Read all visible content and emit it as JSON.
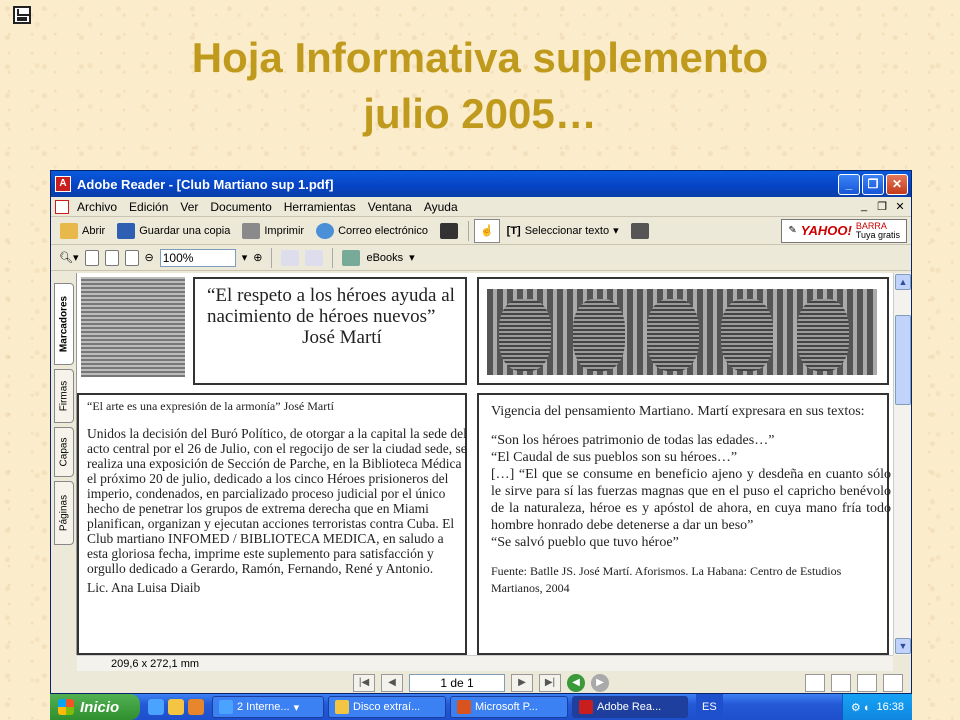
{
  "slide": {
    "title_line1": "Hoja Informativa suplemento",
    "title_line2": "julio 2005…",
    "title_color": "#c09a1c"
  },
  "window": {
    "title": "Adobe Reader - [Club Martiano sup 1.pdf]",
    "menu": [
      "Archivo",
      "Edición",
      "Ver",
      "Documento",
      "Herramientas",
      "Ventana",
      "Ayuda"
    ],
    "toolbar": {
      "open_label": "Abrir",
      "save_copy_label": "Guardar una copia",
      "print_label": "Imprimir",
      "email_label": "Correo electrónico",
      "select_text_label": "Seleccionar texto",
      "yahoo_logo": "YAHOO!",
      "yahoo_bar": "BARRA",
      "yahoo_sub": "Tuya gratis"
    },
    "toolbar2": {
      "zoom_value": "100%",
      "ebooks_label": "eBooks"
    },
    "side_tabs": [
      "Marcadores",
      "Firmas",
      "Capas",
      "Páginas"
    ]
  },
  "document": {
    "quote": "“El respeto a los héroes ayuda al nacimiento de héroes nuevos”",
    "quote_author": "José Martí",
    "col1_heading": "“El arte es una expresión de la armonía”",
    "col1_heading_author": "José Martí",
    "col1_body": "Unidos la decisión del Buró Político, de otorgar a la capital la sede del acto central por el 26 de Julio, con el regocijo de ser la ciudad sede, se realiza una exposición de Sección de Parche, en la Biblioteca Médica el próximo 20 de julio, dedicado a los cinco Héroes prisioneros del imperio, condenados, en parcializado proceso judicial por el único hecho de penetrar los grupos de extrema derecha que en Miami planifican, organizan y ejecutan acciones terroristas contra Cuba. El Club martiano INFOMED / BIBLIOTECA MEDICA, en saludo a esta gloriosa fecha, imprime este suplemento para satisfacción y orgullo dedicado a Gerardo, Ramón, Fernando, René y Antonio.",
    "col1_footer": "Lic. Ana Luisa Diaib",
    "col2_intro": "Vigencia del pensamiento Martiano. Martí expresara en sus textos:",
    "col2_q1": "“Son los héroes patrimonio de todas las edades…”",
    "col2_q2": "“El Caudal de sus pueblos son su héroes…”",
    "col2_q3": "[…] “El que se consume en beneficio ajeno y desdeña en cuanto sólo le sirve para sí las fuerzas magnas que en el puso el capricho benévolo de la naturaleza, héroe es y apóstol de ahora, en cuya mano fría todo hombre honrado debe detenerse a dar un beso”",
    "col2_q4": "“Se salvó pueblo que tuvo héroe”",
    "col2_source": "Fuente: Batlle JS. José Martí. Aforismos. La Habana: Centro de Estudios Martianos, 2004"
  },
  "status": {
    "page_size": "209,6 x 272,1 mm",
    "page_indicator": "1 de 1"
  },
  "taskbar": {
    "start_label": "Inicio",
    "tasks": [
      "2 Interne...",
      "Disco extraí...",
      "Microsoft P...",
      "Adobe Rea..."
    ],
    "language": "ES",
    "clock": "16:38"
  }
}
